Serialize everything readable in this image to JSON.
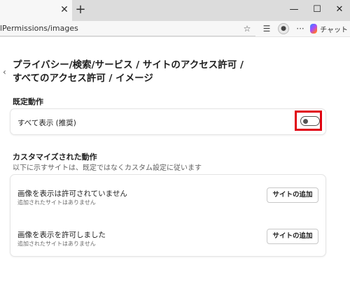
{
  "browser": {
    "tab_close": "✕",
    "new_tab": "+",
    "window_controls": {
      "minimize": "—",
      "maximize": "☐",
      "close": "✕"
    },
    "url": "lPermissions/images",
    "copilot_label": "チャット",
    "icons": [
      "star-icon",
      "favorites-icon",
      "profile-icon",
      "more-icon",
      "copilot-icon"
    ]
  },
  "page": {
    "back_icon": "‹",
    "title_line1": "プライバシー/検索/サービス / サイトのアクセス許可 /",
    "title_line2": "すべてのアクセス許可 / イメージ",
    "default_behavior": {
      "heading": "既定動作",
      "option_label": "すべて表示 (推奨)",
      "toggle_on": false,
      "highlight_color": "#e00010"
    },
    "custom_behavior": {
      "heading": "カスタマイズされた動作",
      "description": "以下に示すサイトは、既定ではなくカスタム設定に従います",
      "rows": [
        {
          "title": "画像を表示は許可されていません",
          "subtitle": "追加されたサイトはありません",
          "button": "サイトの追加"
        },
        {
          "title": "画像を表示を許可しました",
          "subtitle": "追加されたサイトはありません",
          "button": "サイトの追加"
        }
      ]
    }
  }
}
